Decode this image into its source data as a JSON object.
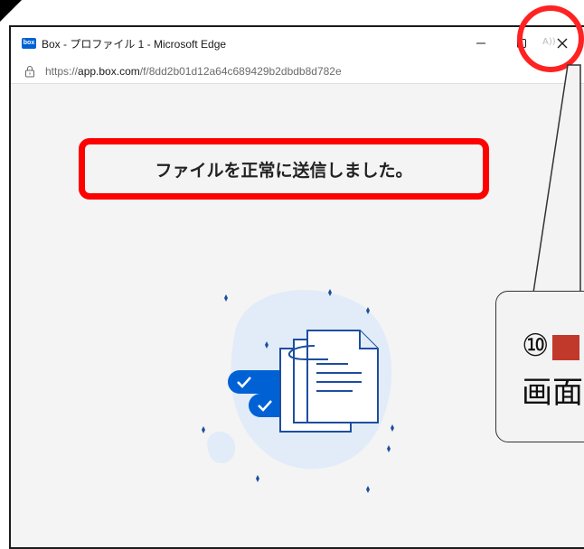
{
  "window": {
    "title": "Box - プロファイル 1 - Microsoft Edge",
    "app_icon_label": "box",
    "url_prefix": "https://",
    "url_host": "app.box.com",
    "url_path": "/f/8dd2b01d12a64c689429b2dbdb8d782e"
  },
  "main": {
    "message": "ファイルを正常に送信しました。"
  },
  "callout": {
    "line1": "⑩",
    "line2": "画面"
  },
  "colors": {
    "highlight": "#ff0000",
    "box_blue": "#0061d5"
  },
  "icons": [
    "lock-icon",
    "minimize-icon",
    "maximize-icon",
    "close-icon",
    "read-aloud-icon",
    "file-sent-illustration"
  ]
}
